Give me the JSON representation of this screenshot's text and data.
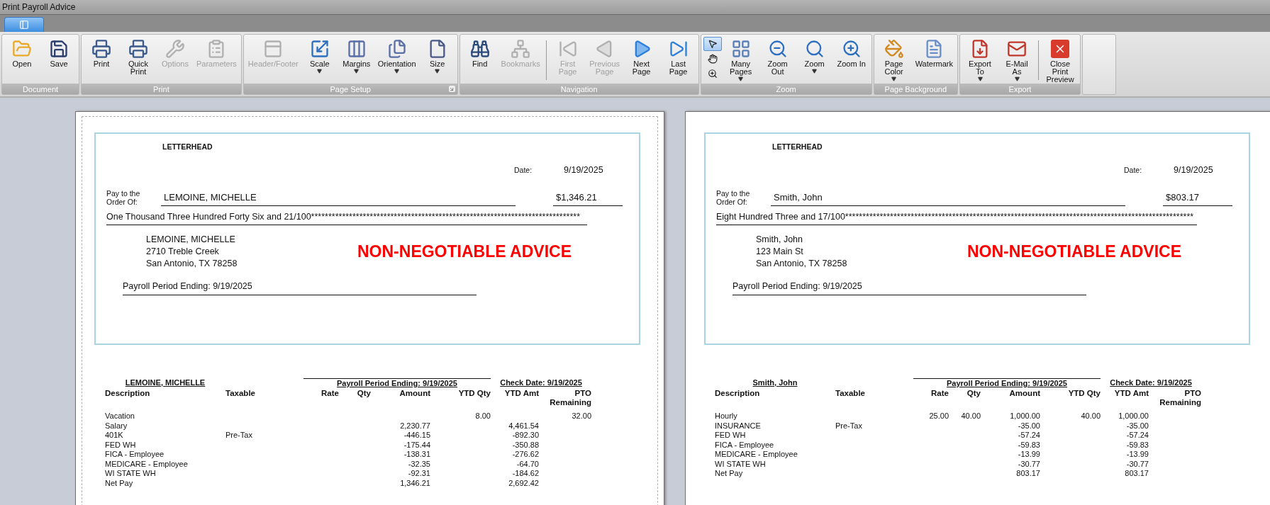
{
  "window": {
    "title": "Print Payroll Advice"
  },
  "ribbon": {
    "groups": [
      {
        "label": "Document",
        "has_launcher": false,
        "items": [
          {
            "kind": "large",
            "label": "Open",
            "disabled": false,
            "menu": false
          },
          {
            "kind": "large",
            "label": "Save",
            "disabled": false,
            "menu": false
          }
        ]
      },
      {
        "label": "Print",
        "has_launcher": false,
        "items": [
          {
            "kind": "large",
            "label": "Print",
            "disabled": false,
            "menu": false
          },
          {
            "kind": "large",
            "label": "Quick Print",
            "disabled": false,
            "menu": false
          },
          {
            "kind": "large",
            "label": "Options",
            "disabled": true,
            "menu": false
          },
          {
            "kind": "large",
            "label": "Parameters",
            "disabled": true,
            "menu": false
          }
        ]
      },
      {
        "label": "Page Setup",
        "has_launcher": true,
        "items": [
          {
            "kind": "large",
            "label": "Header/Footer",
            "disabled": true,
            "menu": false
          },
          {
            "kind": "large",
            "label": "Scale",
            "disabled": false,
            "menu": true
          },
          {
            "kind": "large",
            "label": "Margins",
            "disabled": false,
            "menu": true
          },
          {
            "kind": "large",
            "label": "Orientation",
            "disabled": false,
            "menu": true
          },
          {
            "kind": "large",
            "label": "Size",
            "disabled": false,
            "menu": true
          }
        ]
      },
      {
        "label": "Navigation",
        "has_launcher": false,
        "items": [
          {
            "kind": "large",
            "label": "Find",
            "disabled": false,
            "menu": false
          },
          {
            "kind": "large",
            "label": "Bookmarks",
            "disabled": true,
            "menu": false
          },
          {
            "kind": "separator"
          },
          {
            "kind": "large",
            "label": "First Page",
            "disabled": true,
            "menu": false
          },
          {
            "kind": "large",
            "label": "Previous Page",
            "disabled": true,
            "menu": false
          },
          {
            "kind": "large",
            "label": "Next Page",
            "disabled": false,
            "menu": false
          },
          {
            "kind": "large",
            "label": "Last Page",
            "disabled": false,
            "menu": false
          }
        ]
      },
      {
        "label": "Zoom",
        "has_launcher": false,
        "items": [
          {
            "kind": "tools",
            "tools": [
              {
                "selected": true
              },
              {
                "selected": false
              },
              {
                "selected": false
              }
            ]
          },
          {
            "kind": "large",
            "label": "Many Pages",
            "disabled": false,
            "menu": true
          },
          {
            "kind": "large",
            "label": "Zoom Out",
            "disabled": false,
            "menu": false
          },
          {
            "kind": "large",
            "label": "Zoom",
            "disabled": false,
            "menu": true
          },
          {
            "kind": "large",
            "label": "Zoom In",
            "disabled": false,
            "menu": false
          }
        ]
      },
      {
        "label": "Page Background",
        "has_launcher": false,
        "items": [
          {
            "kind": "large",
            "label": "Page Color",
            "disabled": false,
            "menu": true
          },
          {
            "kind": "large",
            "label": "Watermark",
            "disabled": false,
            "menu": false
          }
        ]
      },
      {
        "label": "Export",
        "has_launcher": false,
        "items": [
          {
            "kind": "large",
            "label": "Export To",
            "disabled": false,
            "menu": true
          },
          {
            "kind": "large",
            "label": "E-Mail As",
            "disabled": false,
            "menu": true
          },
          {
            "kind": "separator"
          },
          {
            "kind": "large",
            "label": "Close Print Preview",
            "disabled": false,
            "menu": false
          }
        ]
      }
    ]
  },
  "pages": [
    {
      "check": {
        "letterhead": "LETTERHEAD",
        "date_label": "Date:",
        "date": "9/19/2025",
        "pay_to_label": "Pay to the Order Of:",
        "payee": "LEMOINE,  MICHELLE",
        "amount": "$1,346.21",
        "amount_words": "One Thousand Three Hundred Forty Six and 21/100******************************************************************************",
        "address": [
          "LEMOINE, MICHELLE",
          "2710 Treble Creek",
          "San Antonio, TX  78258"
        ],
        "stamp": "NON-NEGOTIABLE ADVICE",
        "period": "Payroll Period Ending: 9/19/2025"
      },
      "stub": {
        "employee": "LEMOINE, MICHELLE",
        "period": "Payroll Period Ending: 9/19/2025",
        "check_date": "Check Date: 9/19/2025",
        "columns": [
          "Description",
          "Taxable",
          "Rate",
          "Qty",
          "Amount",
          "YTD Qty",
          "YTD Amt",
          "PTO Remaining"
        ],
        "rows": [
          [
            "Vacation",
            "",
            "",
            "",
            "",
            "8.00",
            "",
            "32.00"
          ],
          [
            "Salary",
            "",
            "",
            "",
            "2,230.77",
            "",
            "4,461.54",
            ""
          ],
          [
            "401K",
            "Pre-Tax",
            "",
            "",
            "-446.15",
            "",
            "-892.30",
            ""
          ],
          [
            "FED WH",
            "",
            "",
            "",
            "-175.44",
            "",
            "-350.88",
            ""
          ],
          [
            "FICA - Employee",
            "",
            "",
            "",
            "-138.31",
            "",
            "-276.62",
            ""
          ],
          [
            "MEDICARE - Employee",
            "",
            "",
            "",
            "-32.35",
            "",
            "-64.70",
            ""
          ],
          [
            "WI STATE WH",
            "",
            "",
            "",
            "-92.31",
            "",
            "-184.62",
            ""
          ],
          [
            "Net Pay",
            "",
            "",
            "",
            "1,346.21",
            "",
            "2,692.42",
            ""
          ]
        ]
      }
    },
    {
      "check": {
        "letterhead": "LETTERHEAD",
        "date_label": "Date:",
        "date": "9/19/2025",
        "pay_to_label": "Pay to the Order Of:",
        "payee": "Smith, John",
        "amount": "$803.17",
        "amount_words": "Eight Hundred Three and 17/100*****************************************************************************************************",
        "address": [
          "Smith, John",
          "123 Main St",
          "San Antonio, TX  78258"
        ],
        "stamp": "NON-NEGOTIABLE ADVICE",
        "period": "Payroll Period Ending: 9/19/2025"
      },
      "stub": {
        "employee": "Smith, John",
        "period": "Payroll Period Ending: 9/19/2025",
        "check_date": "Check Date: 9/19/2025",
        "columns": [
          "Description",
          "Taxable",
          "Rate",
          "Qty",
          "Amount",
          "YTD Qty",
          "YTD Amt",
          "PTO Remaining"
        ],
        "rows": [
          [
            "Hourly",
            "",
            "25.00",
            "40.00",
            "1,000.00",
            "40.00",
            "1,000.00",
            ""
          ],
          [
            "INSURANCE",
            "Pre-Tax",
            "",
            "",
            "-35.00",
            "",
            "-35.00",
            ""
          ],
          [
            "FED WH",
            "",
            "",
            "",
            "-57.24",
            "",
            "-57.24",
            ""
          ],
          [
            "FICA - Employee",
            "",
            "",
            "",
            "-59.83",
            "",
            "-59.83",
            ""
          ],
          [
            "MEDICARE - Employee",
            "",
            "",
            "",
            "-13.99",
            "",
            "-13.99",
            ""
          ],
          [
            "WI STATE WH",
            "",
            "",
            "",
            "-30.77",
            "",
            "-30.77",
            ""
          ],
          [
            "Net Pay",
            "",
            "",
            "",
            "803.17",
            "",
            "803.17",
            ""
          ]
        ]
      }
    }
  ]
}
